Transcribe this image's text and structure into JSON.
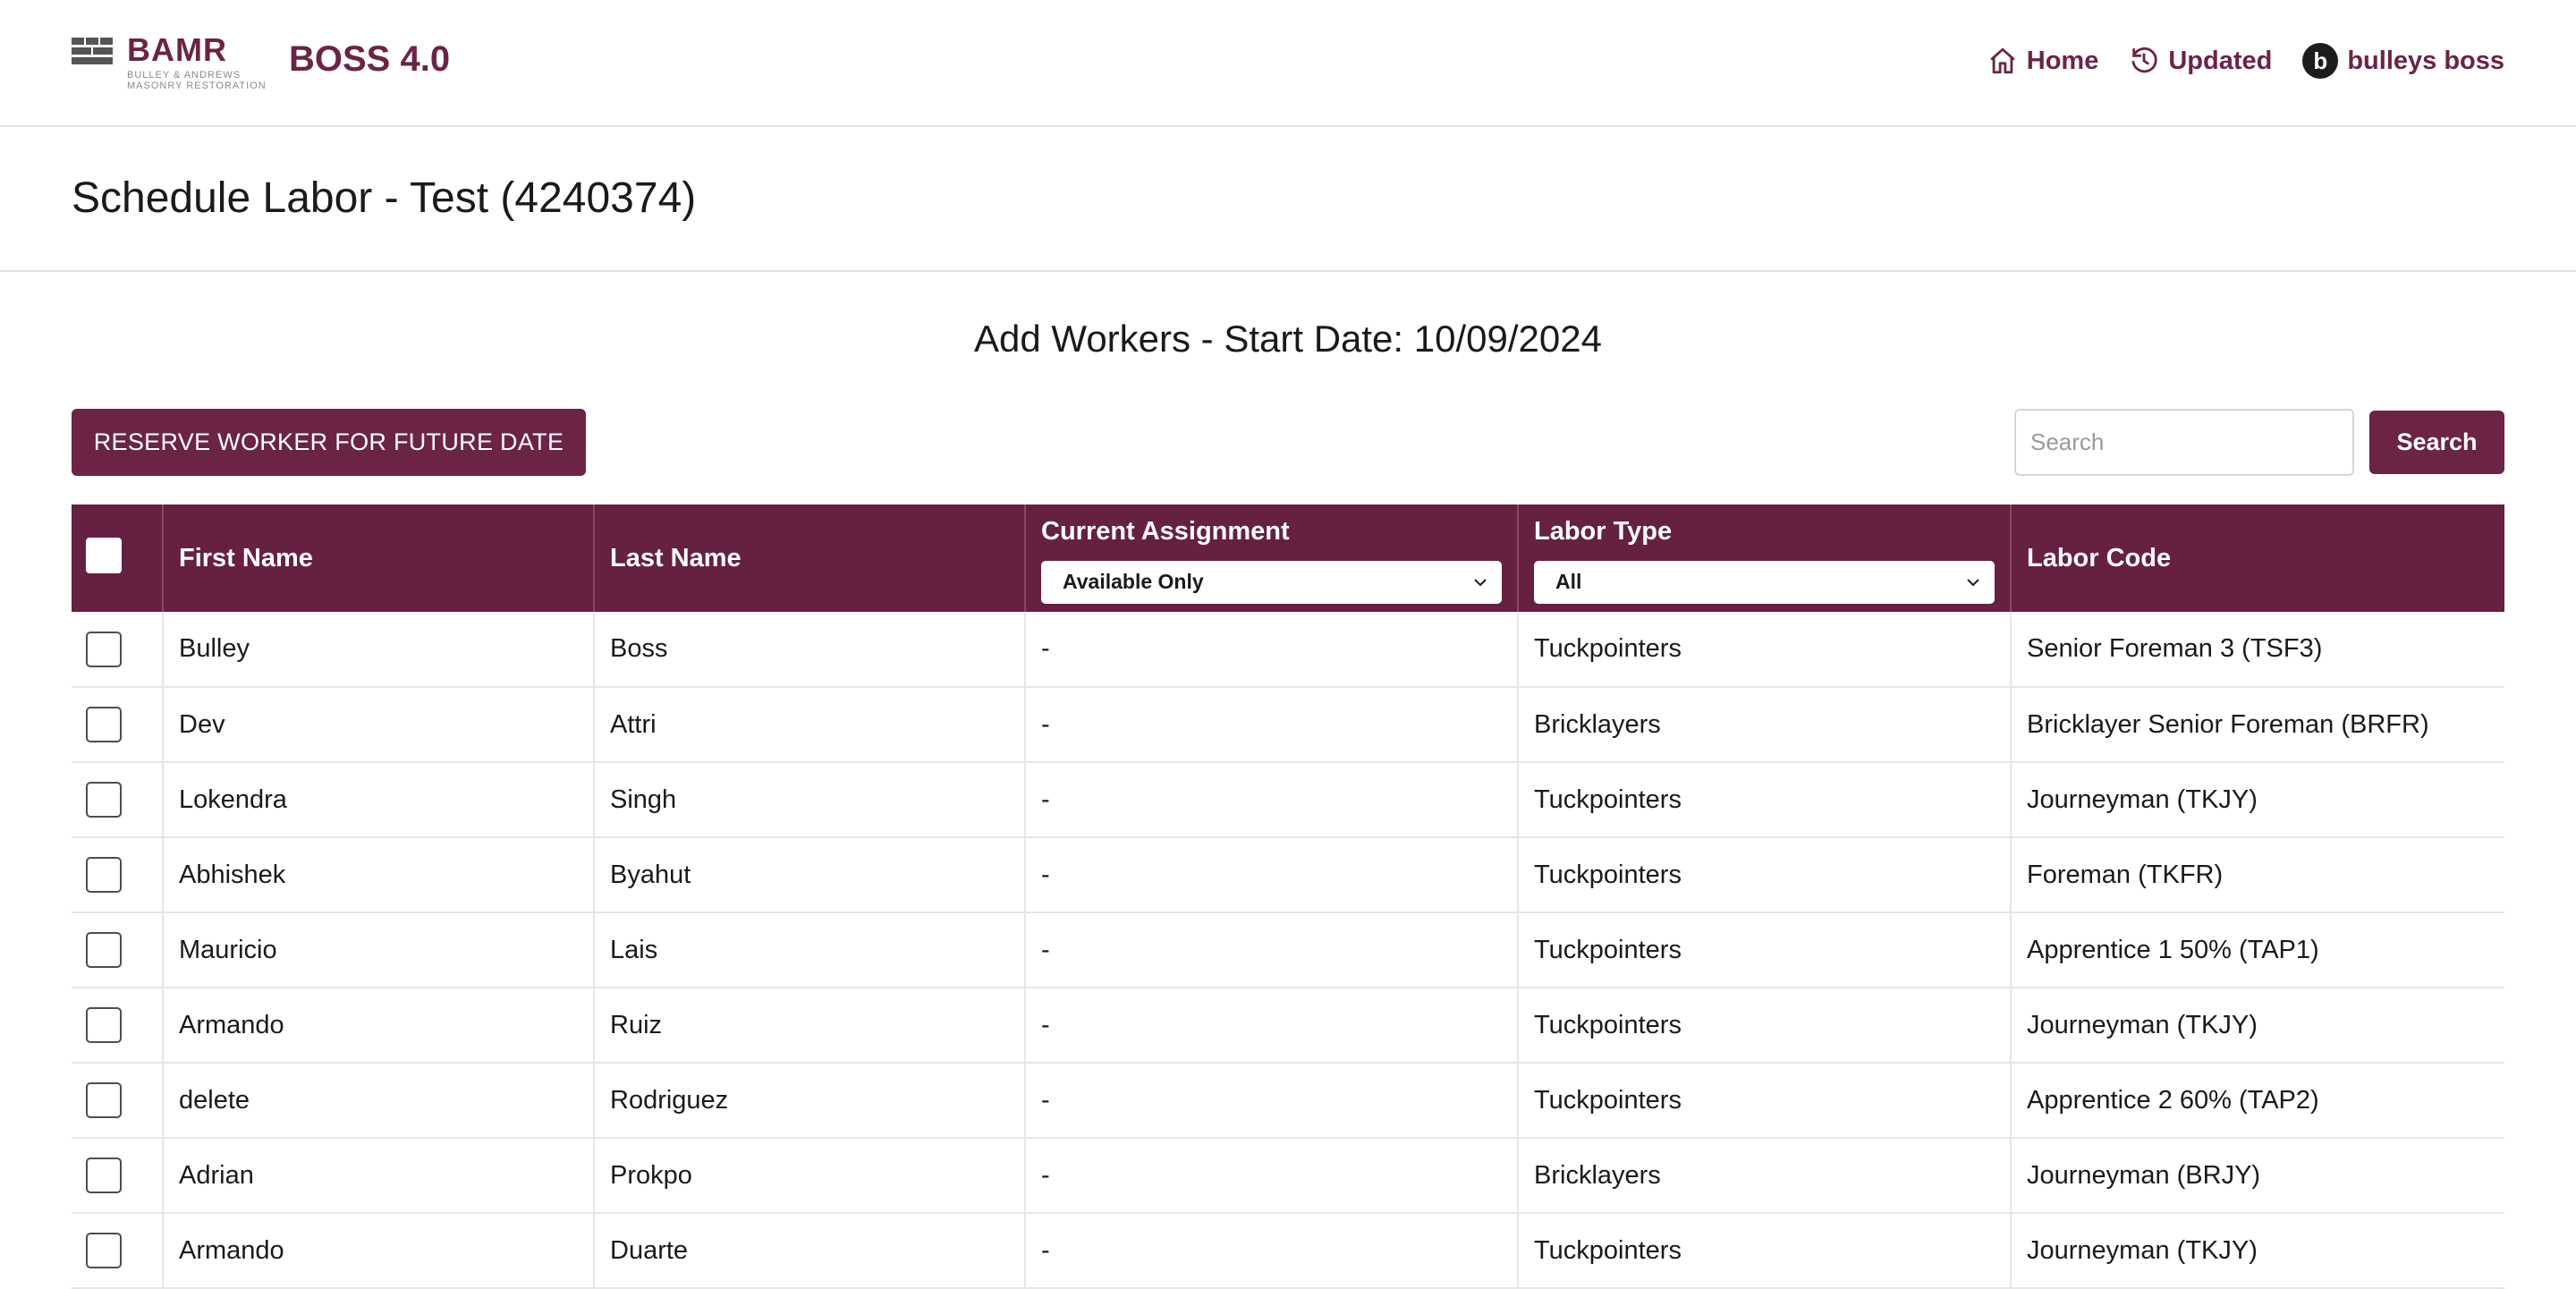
{
  "header": {
    "logo_name": "BAMR",
    "logo_sub_1": "BULLEY & ANDREWS",
    "logo_sub_2": "MASONRY RESTORATION",
    "app_name": "BOSS 4.0",
    "nav": {
      "home": "Home",
      "updated": "Updated",
      "user_initial": "b",
      "user_name": "bulleys boss"
    }
  },
  "page": {
    "title": "Schedule Labor - Test (4240374)",
    "section_title": "Add Workers - Start Date: 10/09/2024"
  },
  "toolbar": {
    "reserve_label": "RESERVE WORKER FOR FUTURE DATE",
    "search_placeholder": "Search",
    "search_button": "Search"
  },
  "table": {
    "columns": {
      "first_name": "First Name",
      "last_name": "Last Name",
      "current_assignment": "Current Assignment",
      "labor_type": "Labor Type",
      "labor_code": "Labor Code"
    },
    "filters": {
      "current_assignment": "Available Only",
      "labor_type": "All"
    },
    "rows": [
      {
        "first": "Bulley",
        "last": "Boss",
        "assignment": "-",
        "type": "Tuckpointers",
        "code": "Senior Foreman 3 (TSF3)"
      },
      {
        "first": "Dev",
        "last": "Attri",
        "assignment": "-",
        "type": "Bricklayers",
        "code": "Bricklayer Senior Foreman (BRFR)"
      },
      {
        "first": "Lokendra",
        "last": "Singh",
        "assignment": "-",
        "type": "Tuckpointers",
        "code": "Journeyman (TKJY)"
      },
      {
        "first": "Abhishek",
        "last": "Byahut",
        "assignment": "-",
        "type": "Tuckpointers",
        "code": "Foreman (TKFR)"
      },
      {
        "first": "Mauricio",
        "last": "Lais",
        "assignment": "-",
        "type": "Tuckpointers",
        "code": "Apprentice 1 50% (TAP1)"
      },
      {
        "first": "Armando",
        "last": "Ruiz",
        "assignment": "-",
        "type": "Tuckpointers",
        "code": "Journeyman (TKJY)"
      },
      {
        "first": "delete",
        "last": "Rodriguez",
        "assignment": "-",
        "type": "Tuckpointers",
        "code": "Apprentice 2 60% (TAP2)"
      },
      {
        "first": "Adrian",
        "last": "Prokpo",
        "assignment": "-",
        "type": "Bricklayers",
        "code": "Journeyman (BRJY)"
      },
      {
        "first": "Armando",
        "last": "Duarte",
        "assignment": "-",
        "type": "Tuckpointers",
        "code": "Journeyman (TKJY)"
      }
    ]
  },
  "colors": {
    "brand": "#6b2446",
    "header_bg": "#652042"
  }
}
